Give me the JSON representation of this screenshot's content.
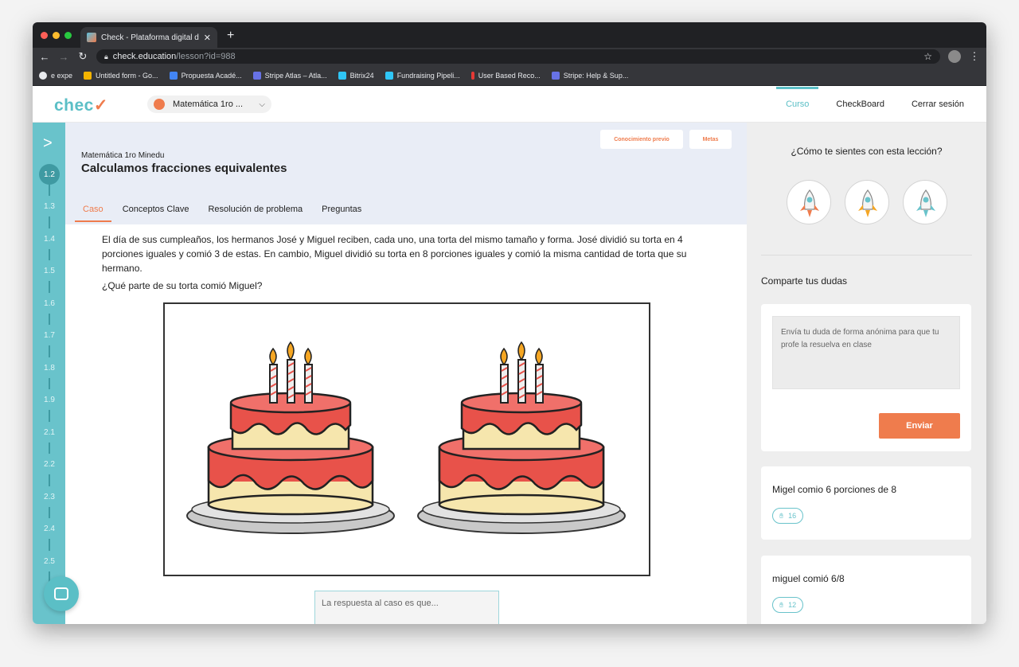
{
  "browser": {
    "tab_title": "Check - Plataforma digital de a",
    "tab_close": "✕",
    "new_tab": "+",
    "url_host": "check.education",
    "url_path": "/lesson?id=988",
    "bookmarks": [
      "e expe",
      "Untitled form - Go...",
      "Propuesta Acadé...",
      "Stripe Atlas – Atla...",
      "Bitrix24",
      "Fundraising Pipeli...",
      "User Based Reco...",
      "Stripe: Help & Sup..."
    ]
  },
  "header": {
    "logo_main": "chec",
    "logo_accent": "✓",
    "course": "Matemática 1ro ...",
    "nav": [
      "Curso",
      "CheckBoard",
      "Cerrar sesión"
    ]
  },
  "rail": {
    "items": [
      "1.2",
      "1.3",
      "1.4",
      "1.5",
      "1.6",
      "1.7",
      "1.8",
      "1.9",
      "2.1",
      "2.2",
      "2.3",
      "2.4",
      "2.5"
    ]
  },
  "lesson": {
    "btn_prior": "Conocimiento previo",
    "btn_goals": "Metas",
    "subtitle": "Matemática 1ro Minedu",
    "title": "Calculamos fracciones equivalentes",
    "tabs": [
      "Caso",
      "Conceptos Clave",
      "Resolución de problema",
      "Preguntas"
    ],
    "paragraph": "El día de sus cumpleaños, los hermanos José y Miguel reciben, cada uno, una torta del mismo tamaño y forma. José dividió su torta en 4 porciones iguales y comió 3 de estas. En cambio, Miguel dividió su torta en 8 porciones iguales y comió la misma cantidad de torta que su hermano.",
    "question": "¿Qué parte de su torta comió Miguel?",
    "answer_placeholder": "La respuesta al caso es que..."
  },
  "side": {
    "feel_question": "¿Cómo te sientes con esta lección?",
    "doubts_title": "Comparte tus dudas",
    "doubt_placeholder": "Envía tu duda de forma anónima para que tu profe la resuelva en clase",
    "send": "Enviar",
    "doubts": [
      {
        "text": "Migel comio 6 porciones de 8",
        "likes": "16"
      },
      {
        "text": "miguel comió 6/8",
        "likes": "12"
      }
    ]
  },
  "colors": {
    "accent": "#ef7c4d",
    "teal": "#69c3cb"
  }
}
